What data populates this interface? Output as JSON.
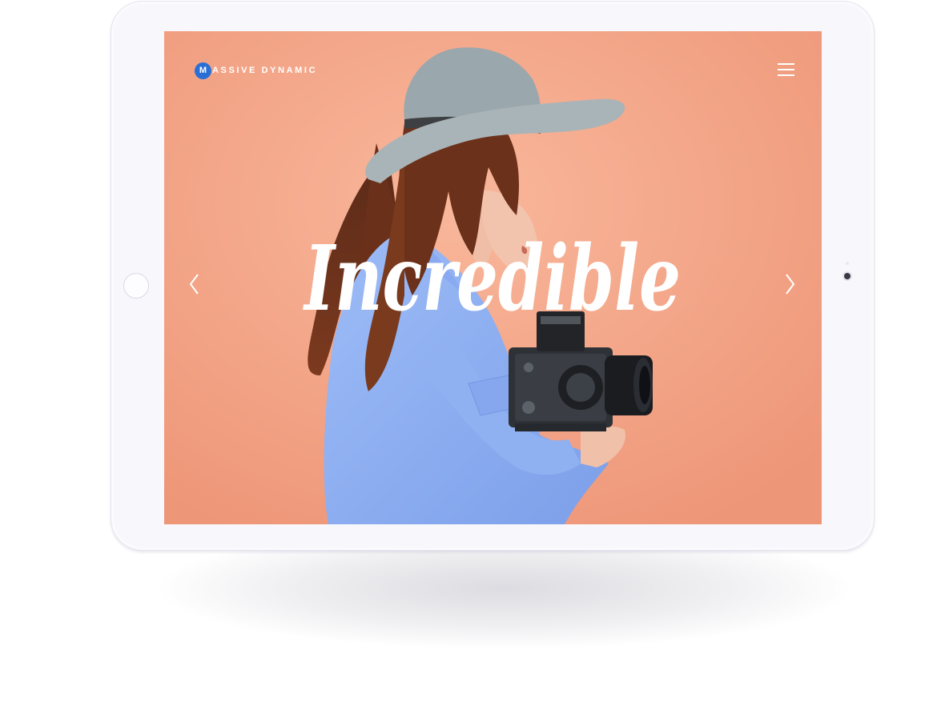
{
  "header": {
    "brand_initial": "M",
    "brand_name": "ASSIVE DYNAMIC"
  },
  "hero": {
    "headline": "Incredible"
  },
  "icons": {
    "menu": "hamburger-menu-icon",
    "prev": "chevron-left-icon",
    "next": "chevron-right-icon"
  },
  "colors": {
    "background": "#f2a183",
    "brand_accent": "#2a6fd6",
    "text": "#ffffff"
  }
}
